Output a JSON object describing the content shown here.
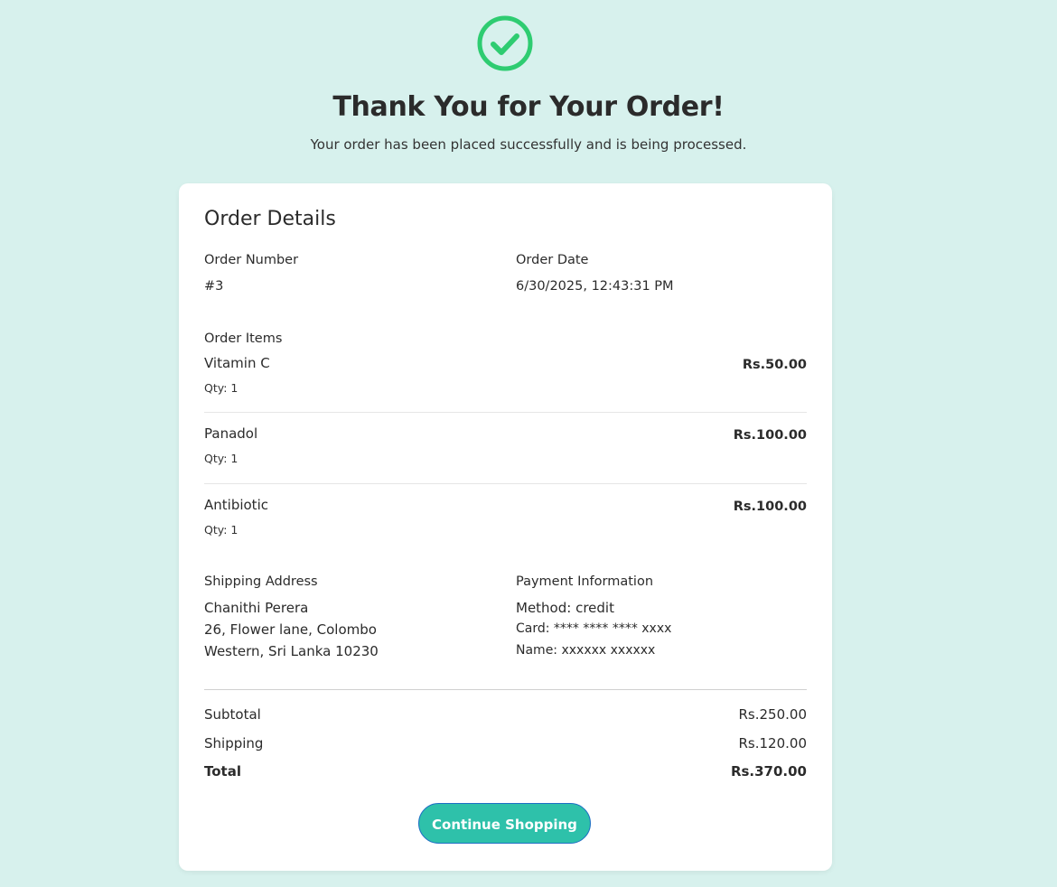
{
  "header": {
    "title": "Thank You for Your Order!",
    "subtitle": "Your order has been placed successfully and is being processed.",
    "icon": "check-circle-icon",
    "icon_color": "#2ecc71"
  },
  "order": {
    "section_title": "Order Details",
    "number_label": "Order Number",
    "number_value": "#3",
    "date_label": "Order Date",
    "date_value": "6/30/2025, 12:43:31 PM",
    "items_label": "Order Items",
    "items": [
      {
        "name": "Vitamin C",
        "qty": "Qty: 1",
        "price": "Rs.50.00"
      },
      {
        "name": "Panadol",
        "qty": "Qty: 1",
        "price": "Rs.100.00"
      },
      {
        "name": "Antibiotic",
        "qty": "Qty: 1",
        "price": "Rs.100.00"
      }
    ]
  },
  "shipping": {
    "label": "Shipping Address",
    "name": "Chanithi Perera",
    "line1": "26, Flower lane, Colombo",
    "line2": "Western, Sri Lanka 10230"
  },
  "payment": {
    "label": "Payment Information",
    "method": "Method: credit",
    "card": "Card: **** **** **** xxxx",
    "name": "Name: xxxxxx xxxxxx"
  },
  "totals": {
    "subtotal_label": "Subtotal",
    "subtotal_value": "Rs.250.00",
    "shipping_label": "Shipping",
    "shipping_value": "Rs.120.00",
    "total_label": "Total",
    "total_value": "Rs.370.00"
  },
  "actions": {
    "continue_label": "Continue Shopping",
    "button_color": "#2ec1aa"
  },
  "colors": {
    "background": "#d7f1ed",
    "card": "#ffffff",
    "accent_green": "#2ecc71"
  }
}
